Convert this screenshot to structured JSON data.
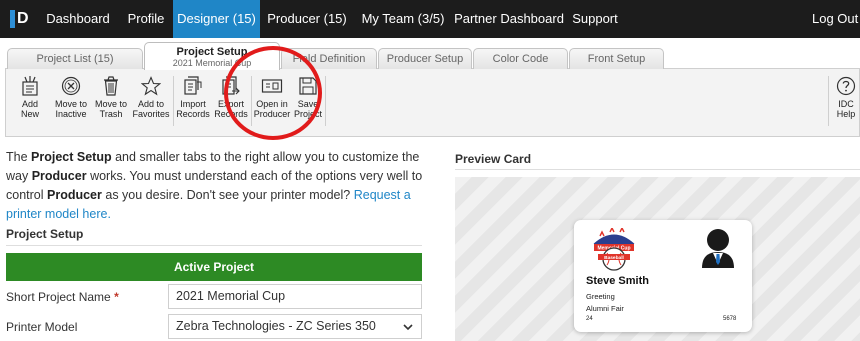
{
  "nav": {
    "logo": "D",
    "items": [
      {
        "label": "Dashboard",
        "active": false
      },
      {
        "label": "Profile",
        "active": false
      },
      {
        "label": "Designer (15)",
        "active": true
      },
      {
        "label": "Producer (15)",
        "active": false
      },
      {
        "label": "My Team (3/5)",
        "active": false
      },
      {
        "label": "Partner Dashboard",
        "active": false
      },
      {
        "label": "Support",
        "active": false
      }
    ],
    "logout": "Log Out"
  },
  "tabs": [
    {
      "label": "Project List (15)"
    },
    {
      "label": "Project Setup",
      "sublabel": "2021 Memorial Cup",
      "active": true
    },
    {
      "label": "Field Definition"
    },
    {
      "label": "Producer Setup"
    },
    {
      "label": "Color Code"
    },
    {
      "label": "Front Setup"
    }
  ],
  "toolbar": {
    "add_new": {
      "line1": "Add",
      "line2": "New"
    },
    "move_inactive": {
      "line1": "Move to",
      "line2": "Inactive"
    },
    "move_trash": {
      "line1": "Move to",
      "line2": "Trash"
    },
    "add_favorites": {
      "line1": "Add to",
      "line2": "Favorites"
    },
    "import_records": {
      "line1": "Import",
      "line2": "Records"
    },
    "export_records": {
      "line1": "Export",
      "line2": "Records"
    },
    "open_producer": {
      "line1": "Open in",
      "line2": "Producer"
    },
    "save_project": {
      "line1": "Save",
      "line2": "Project"
    },
    "idc_help": {
      "line1": "IDC",
      "line2": "Help"
    }
  },
  "intro": {
    "p1": "The ",
    "b1": "Project Setup",
    "p2": " and smaller tabs to the right allow you to customize the way ",
    "b2": "Producer",
    "p3": " works. You must understand each of the options very well to control ",
    "b3": "Producer",
    "p4": " as you desire. Don't see your printer model? ",
    "link": "Request a printer model here."
  },
  "section_title": "Project Setup",
  "active_bar": "Active Project",
  "fields": {
    "short_name_label": "Short Project Name",
    "required_mark": "*",
    "short_name_value": "2021 Memorial Cup",
    "printer_label": "Printer Model",
    "printer_value": "Zebra Technologies - ZC Series 350"
  },
  "preview": {
    "title": "Preview Card",
    "card": {
      "logo_text_top": "Memorial Cup",
      "logo_text_bottom": "Baseball",
      "name": "Steve Smith",
      "line1": "Greeting",
      "line2": "Alumni Fair",
      "num_left": "24",
      "num_right": "5678"
    }
  },
  "colors": {
    "nav_bg": "#1c1c1c",
    "nav_active": "#1f86c7",
    "active_bar": "#2d8a24",
    "annotation": "#e11b1b",
    "link": "#1f86c7"
  }
}
